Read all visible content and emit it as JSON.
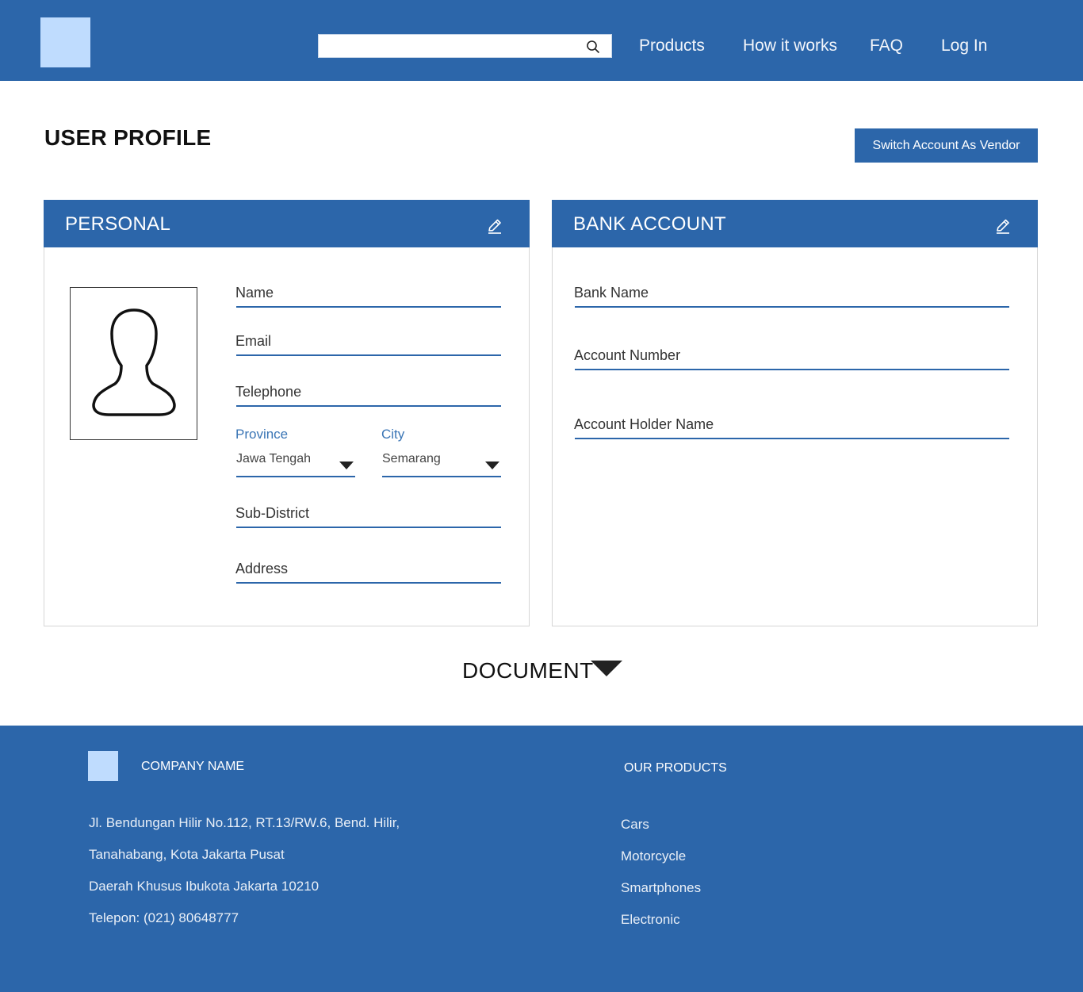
{
  "header": {
    "search_placeholder": "",
    "nav": {
      "products": "Products",
      "how_it_works": "How it works",
      "faq": "FAQ",
      "login": "Log In"
    }
  },
  "page": {
    "title": "USER PROFILE",
    "switch_button": "Switch Account As Vendor"
  },
  "personal": {
    "title": "PERSONAL",
    "fields": {
      "name": "Name",
      "email": "Email",
      "telephone": "Telephone",
      "province_label": "Province",
      "province_value": "Jawa Tengah",
      "city_label": "City",
      "city_value": "Semarang",
      "sub_district": "Sub-District",
      "address": "Address"
    }
  },
  "bank": {
    "title": "BANK ACCOUNT",
    "fields": {
      "bank_name": "Bank Name",
      "account_number": "Account Number",
      "account_holder": "Account Holder Name"
    }
  },
  "document": {
    "label": "DOCUMENT"
  },
  "footer": {
    "company_name": "COMPANY NAME",
    "address": [
      "Jl. Bendungan Hilir No.112, RT.13/RW.6, Bend. Hilir,",
      "Tanahabang, Kota Jakarta Pusat",
      "Daerah Khusus Ibukota Jakarta 10210",
      "Telepon: (021) 80648777"
    ],
    "products_title": "OUR PRODUCTS",
    "products": [
      "Cars",
      "Motorcycle",
      "Smartphones",
      "Electronic"
    ]
  },
  "colors": {
    "primary": "#2c66aa",
    "logo_placeholder": "#bfdcfe"
  },
  "icons": {
    "search": "search-icon",
    "edit": "pencil-icon",
    "avatar": "user-silhouette-icon",
    "dropdown": "caret-down-icon"
  }
}
